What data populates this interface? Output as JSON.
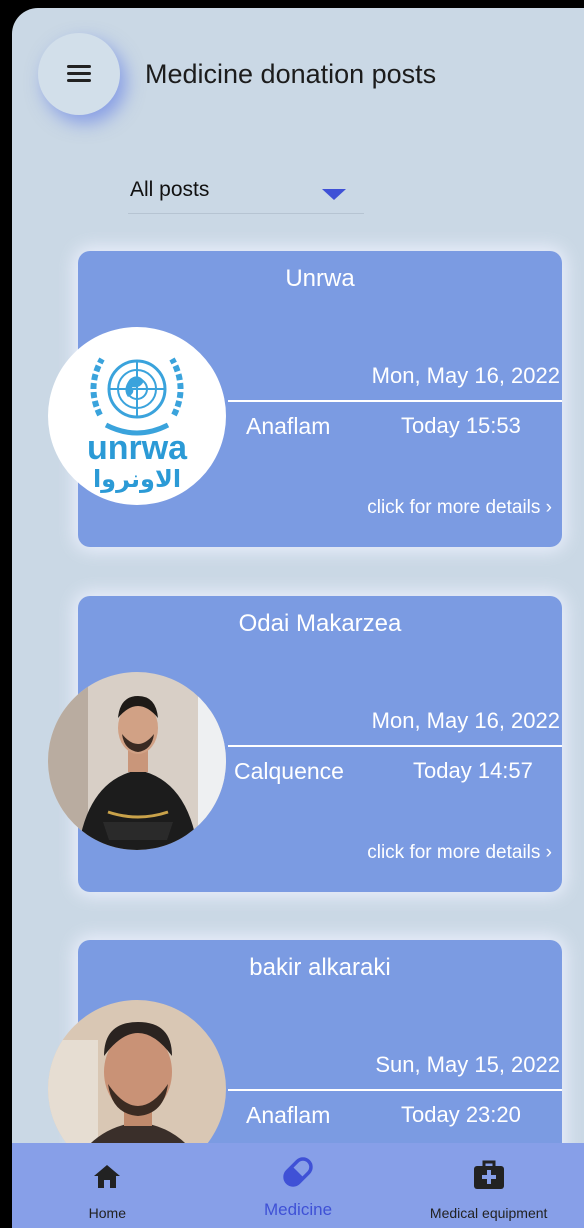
{
  "header": {
    "title": "Medicine donation posts",
    "menu_icon": "hamburger-menu-icon"
  },
  "filter": {
    "selected": "All posts",
    "icon": "caret-down-icon"
  },
  "posts": [
    {
      "name": "Unrwa",
      "date": "Mon, May 16, 2022",
      "medicine": "Anaflam",
      "time": "Today 15:53",
      "details": "click for more details ›",
      "logo_text": "unrwa",
      "logo_arabic": "الاونروا"
    },
    {
      "name": "Odai Makarzea",
      "date": "Mon, May 16, 2022",
      "medicine": "Calquence",
      "time": "Today 14:57",
      "details": "click for more details ›"
    },
    {
      "name": "bakir alkaraki",
      "date": "Sun, May 15, 2022",
      "medicine": "Anaflam",
      "time": "Today 23:20"
    }
  ],
  "bottom_nav": {
    "items": [
      {
        "label": "Home",
        "icon": "home-icon",
        "active": false
      },
      {
        "label": "Medicine",
        "icon": "pill-icon",
        "active": true
      },
      {
        "label": "Medical equipment",
        "icon": "medical-kit-icon",
        "active": false
      }
    ],
    "active_color": "#3f51d6",
    "inactive_color": "#222222"
  },
  "colors": {
    "background": "#cad8e5",
    "card": "#7b9be2",
    "accent": "#3f51d6",
    "nav": "#879fe8"
  }
}
